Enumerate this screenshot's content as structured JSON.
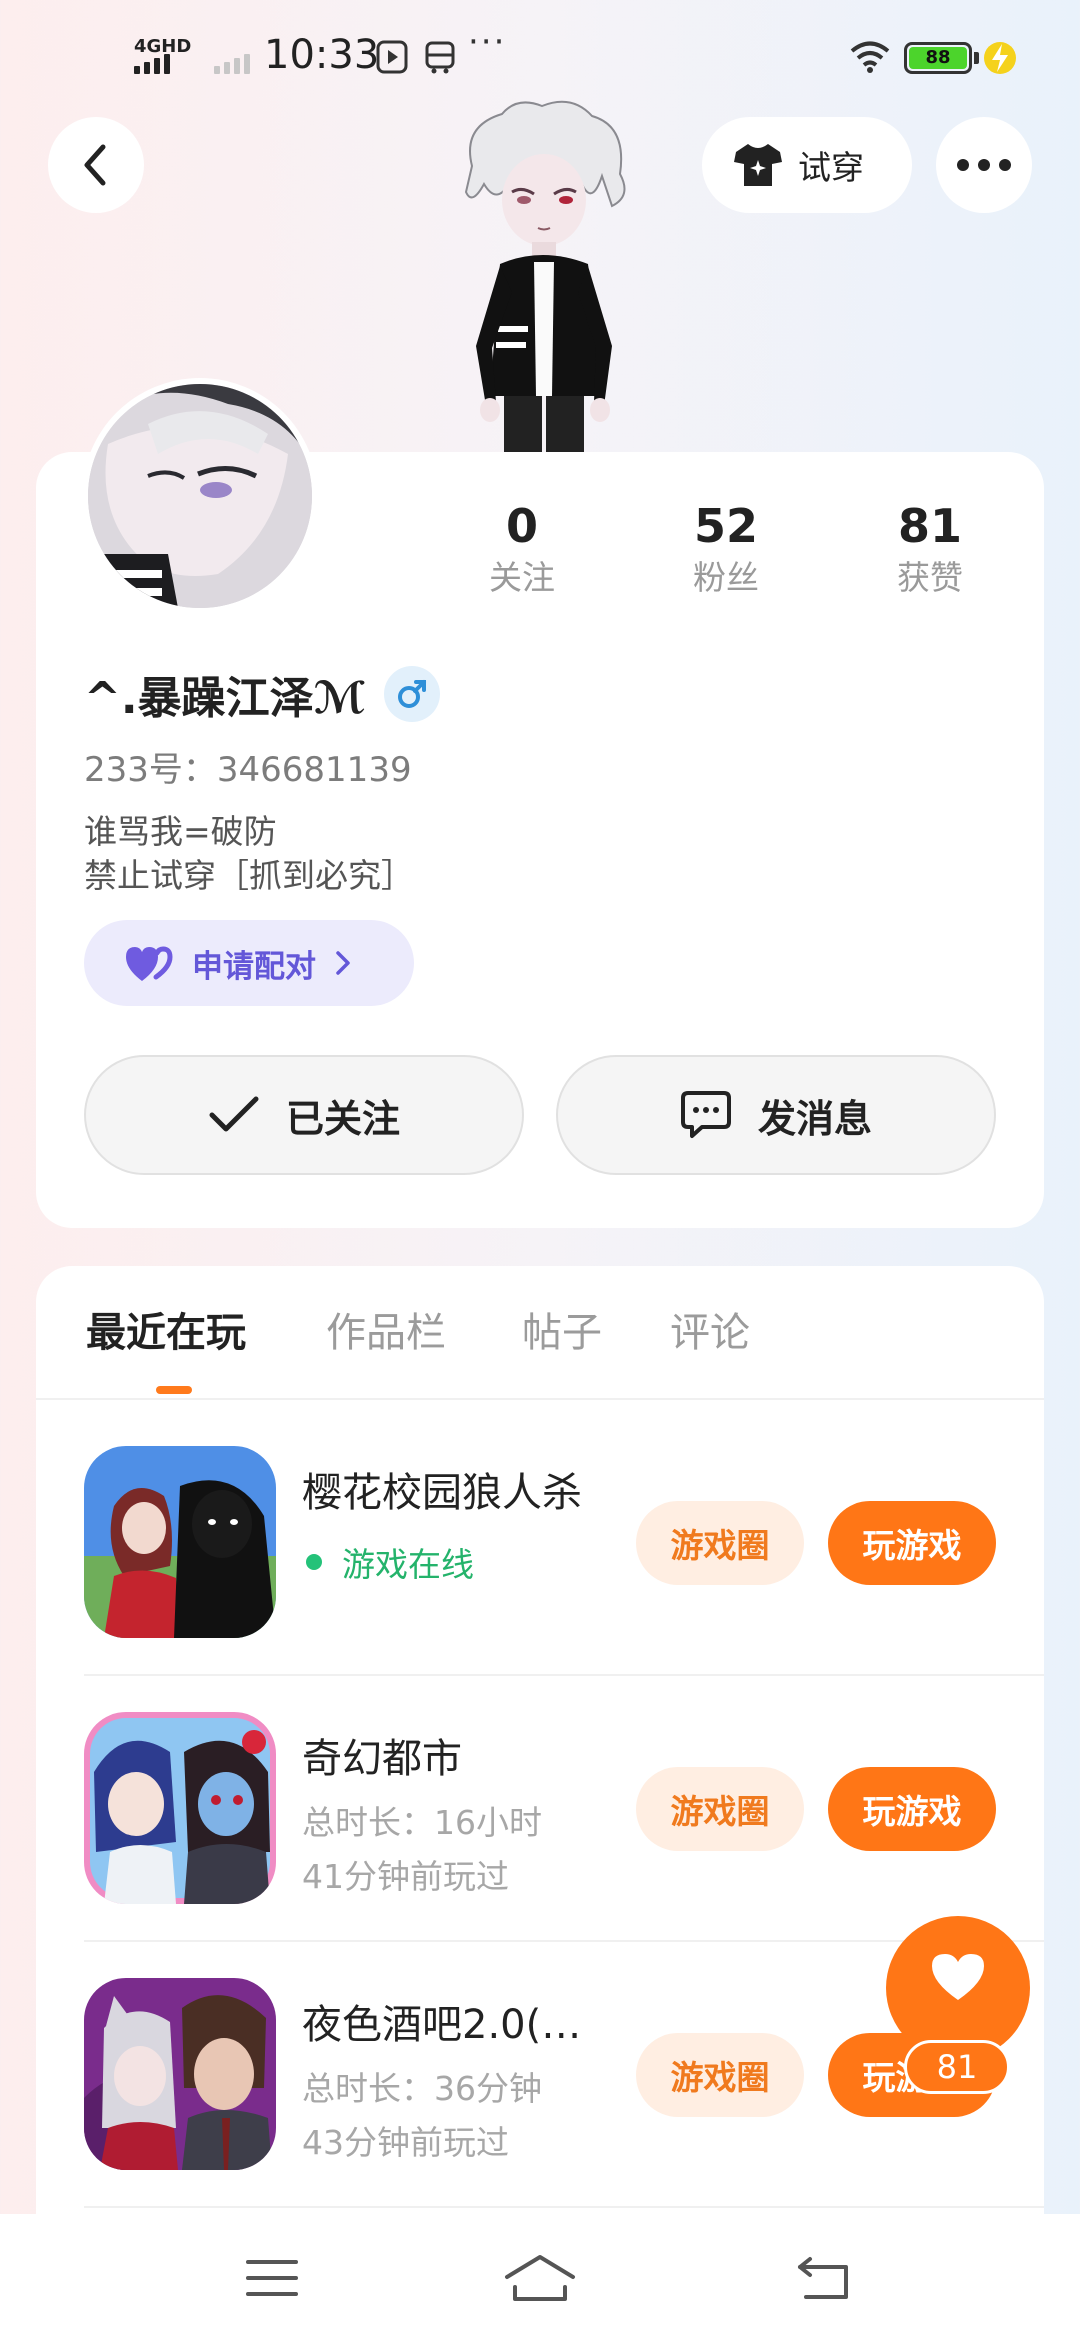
{
  "status_bar": {
    "network": "4GHD",
    "time": "10:33",
    "more": "···",
    "battery": "88"
  },
  "header": {
    "tryon_label": "试穿"
  },
  "profile": {
    "stats": [
      {
        "value": "0",
        "label": "关注"
      },
      {
        "value": "52",
        "label": "粉丝"
      },
      {
        "value": "81",
        "label": "获赞"
      }
    ],
    "name": "^.暴躁江泽ℳ",
    "gender": "male",
    "uid": "233号：346681139",
    "bio_line1": "谁骂我=破防",
    "bio_line2": "禁止试穿［抓到必究］",
    "pair_label": "申请配对",
    "follow_label": "已关注",
    "message_label": "发消息"
  },
  "tabs": [
    {
      "label": "最近在玩",
      "active": true
    },
    {
      "label": "作品栏",
      "active": false
    },
    {
      "label": "帖子",
      "active": false
    },
    {
      "label": "评论",
      "active": false
    }
  ],
  "games": [
    {
      "title": "樱花校园狼人杀",
      "status": "游戏在线",
      "circle_label": "游戏圈",
      "play_label": "玩游戏"
    },
    {
      "title": "奇幻都市",
      "duration": "总时长：16小时",
      "last_played": "41分钟前玩过",
      "circle_label": "游戏圈",
      "play_label": "玩游戏"
    },
    {
      "title": "夜色酒吧2.0(…",
      "duration": "总时长：36分钟",
      "last_played": "43分钟前玩过",
      "circle_label": "游戏圈",
      "play_label": "玩游戏"
    }
  ],
  "like_fab": {
    "count": "81"
  },
  "colors": {
    "accent": "#ff7616",
    "online_green": "#24b36b",
    "pair_purple": "#6357d8"
  }
}
